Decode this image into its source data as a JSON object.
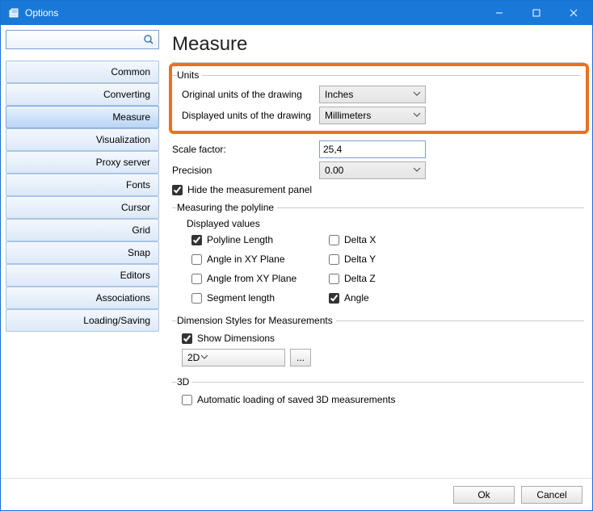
{
  "window": {
    "title": "Options"
  },
  "sidebar": {
    "search_placeholder": "",
    "items": [
      {
        "label": "Common"
      },
      {
        "label": "Converting"
      },
      {
        "label": "Measure"
      },
      {
        "label": "Visualization"
      },
      {
        "label": "Proxy server"
      },
      {
        "label": "Fonts"
      },
      {
        "label": "Cursor"
      },
      {
        "label": "Grid"
      },
      {
        "label": "Snap"
      },
      {
        "label": "Editors"
      },
      {
        "label": "Associations"
      },
      {
        "label": "Loading/Saving"
      }
    ],
    "selected_index": 2
  },
  "page": {
    "heading": "Measure",
    "units": {
      "legend": "Units",
      "original_label": "Original units of the drawing",
      "original_value": "Inches",
      "displayed_label": "Displayed units of the drawing",
      "displayed_value": "Millimeters"
    },
    "scale": {
      "label": "Scale factor:",
      "value": "25,4"
    },
    "precision": {
      "label": "Precision",
      "value": "0.00"
    },
    "hide_panel": {
      "label": "Hide the measurement panel",
      "checked": true
    },
    "polyline": {
      "legend": "Measuring the polyline",
      "displayed_values_label": "Displayed values",
      "options": [
        {
          "label": "Polyline Length",
          "checked": true
        },
        {
          "label": "Delta X",
          "checked": false
        },
        {
          "label": "Angle in XY Plane",
          "checked": false
        },
        {
          "label": "Delta Y",
          "checked": false
        },
        {
          "label": "Angle from XY Plane",
          "checked": false
        },
        {
          "label": "Delta Z",
          "checked": false
        },
        {
          "label": "Segment length",
          "checked": false
        },
        {
          "label": "Angle",
          "checked": true
        }
      ]
    },
    "dimstyles": {
      "legend": "Dimension Styles for Measurements",
      "show_label": "Show Dimensions",
      "show_checked": true,
      "style_value": "2D",
      "dots": "..."
    },
    "threeD": {
      "legend": "3D",
      "auto_label": "Automatic loading of saved 3D measurements",
      "auto_checked": false
    }
  },
  "footer": {
    "ok": "Ok",
    "cancel": "Cancel"
  }
}
